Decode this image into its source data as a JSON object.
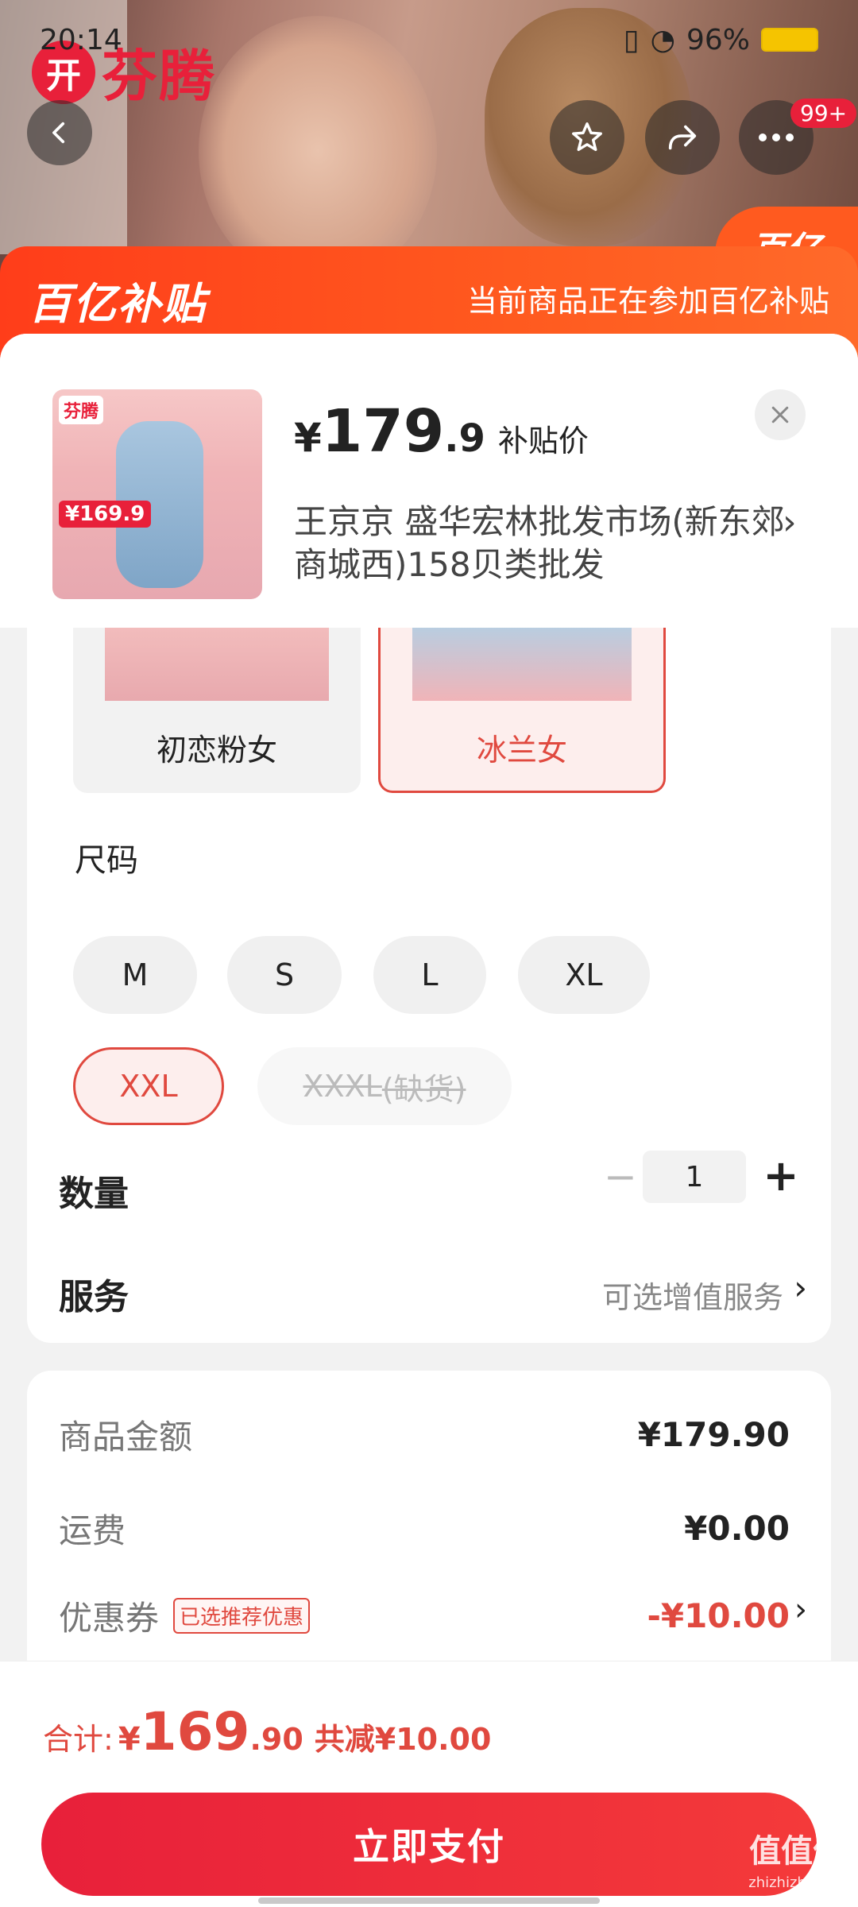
{
  "status_bar": {
    "time": "20:14",
    "battery": "96%"
  },
  "hero": {
    "brand_mark": "开",
    "brand_name": "芬腾",
    "corner_badge": "百亿"
  },
  "nav": {
    "back_icon": "chevron-left-icon",
    "fav_icon": "star-icon",
    "share_icon": "share-icon",
    "more_icon": "more-icon",
    "notification_count": "99+"
  },
  "subsidy": {
    "logo": "百亿补贴",
    "note": "当前商品正在参加百亿补贴"
  },
  "product": {
    "thumb_brand": "芬腾",
    "thumb_tag": "¥169.9",
    "price_symbol": "¥",
    "price_int": "179",
    "price_dec": ".9",
    "price_label": "补贴价",
    "seller": "王京京  盛华宏林批发市场(新东郊商城西)158贝类批发"
  },
  "colors": [
    {
      "label": "初恋粉女",
      "selected": false
    },
    {
      "label": "冰兰女",
      "selected": true
    }
  ],
  "size": {
    "title": "尺码",
    "options": [
      {
        "label": "M",
        "state": "normal"
      },
      {
        "label": "S",
        "state": "normal"
      },
      {
        "label": "L",
        "state": "normal"
      },
      {
        "label": "XL",
        "state": "normal"
      },
      {
        "label": "XXL",
        "state": "selected"
      },
      {
        "label": "XXXL",
        "suffix": "(缺货)",
        "state": "disabled"
      }
    ]
  },
  "quantity": {
    "title": "数量",
    "minus": "−",
    "value": "1",
    "plus": "+"
  },
  "service": {
    "title": "服务",
    "value": "可选增值服务"
  },
  "summary": {
    "goods_label": "商品金额",
    "goods_value": "¥179.90",
    "shipping_label": "运费",
    "shipping_value": "¥0.00",
    "coupon_label": "优惠券",
    "coupon_tag": "已选推荐优惠",
    "coupon_value": "-¥10.00"
  },
  "footer": {
    "total_label": "合计:",
    "total_yen": "¥",
    "total_int": "169",
    "total_dec": ".90",
    "saved": "共减¥10.00",
    "pay_label": "立即支付"
  },
  "watermark": {
    "main": "值值值",
    "sub": "zhizhizhi.com"
  },
  "colors_theme": {
    "accent": "#e0493f",
    "subsidy": "#ff4a1f"
  }
}
